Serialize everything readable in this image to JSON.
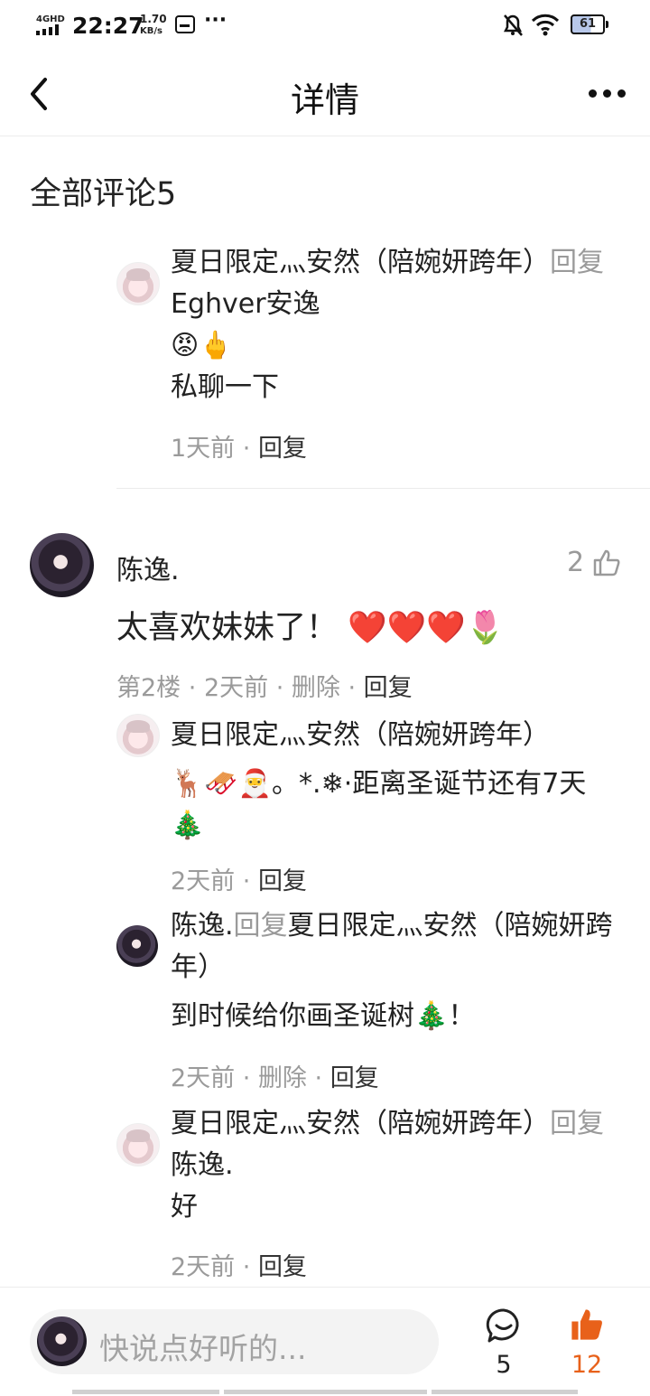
{
  "status_bar": {
    "network": "4GHD",
    "time": "22:27",
    "speed_value": "1.70",
    "speed_unit": "KB/s",
    "more": "···",
    "battery": "61"
  },
  "nav": {
    "title": "详情"
  },
  "comments_header": "全部评论5",
  "thread1_reply": {
    "author": "夏日限定灬安然（陪婉妍跨年）",
    "reply_word": "回复",
    "target": "Eghver安逸",
    "emoji": "😡🖕",
    "text": "私聊一下",
    "time": "1天前",
    "reply_action": "回复"
  },
  "comment2": {
    "author": "陈逸.",
    "likes": "2",
    "text": "太喜欢妹妹了！ ❤️❤️❤️🌷",
    "floor": "第2楼",
    "time": "2天前",
    "delete_action": "删除",
    "reply_action": "回复"
  },
  "reply_a": {
    "author": "夏日限定灬安然（陪婉妍跨年）",
    "text": "🦌🛷🎅。*.❄·距离圣诞节还有7天🎄",
    "time": "2天前",
    "reply_action": "回复"
  },
  "reply_b": {
    "author": "陈逸.",
    "reply_word": "回复",
    "target": "夏日限定灬安然（陪婉妍跨年）",
    "text": "到时候给你画圣诞树🎄！",
    "time": "2天前",
    "delete_action": "删除",
    "reply_action": "回复"
  },
  "reply_c": {
    "author": "夏日限定灬安然（陪婉妍跨年）",
    "reply_word": "回复",
    "target": "陈逸.",
    "text": "好",
    "time": "2天前",
    "reply_action": "回复"
  },
  "bottom": {
    "input_placeholder": "快说点好听的...",
    "comment_count": "5",
    "like_count": "12"
  },
  "colors": {
    "accent": "#e8611a",
    "muted": "#9a9a9a",
    "heart": "#e0241b"
  }
}
